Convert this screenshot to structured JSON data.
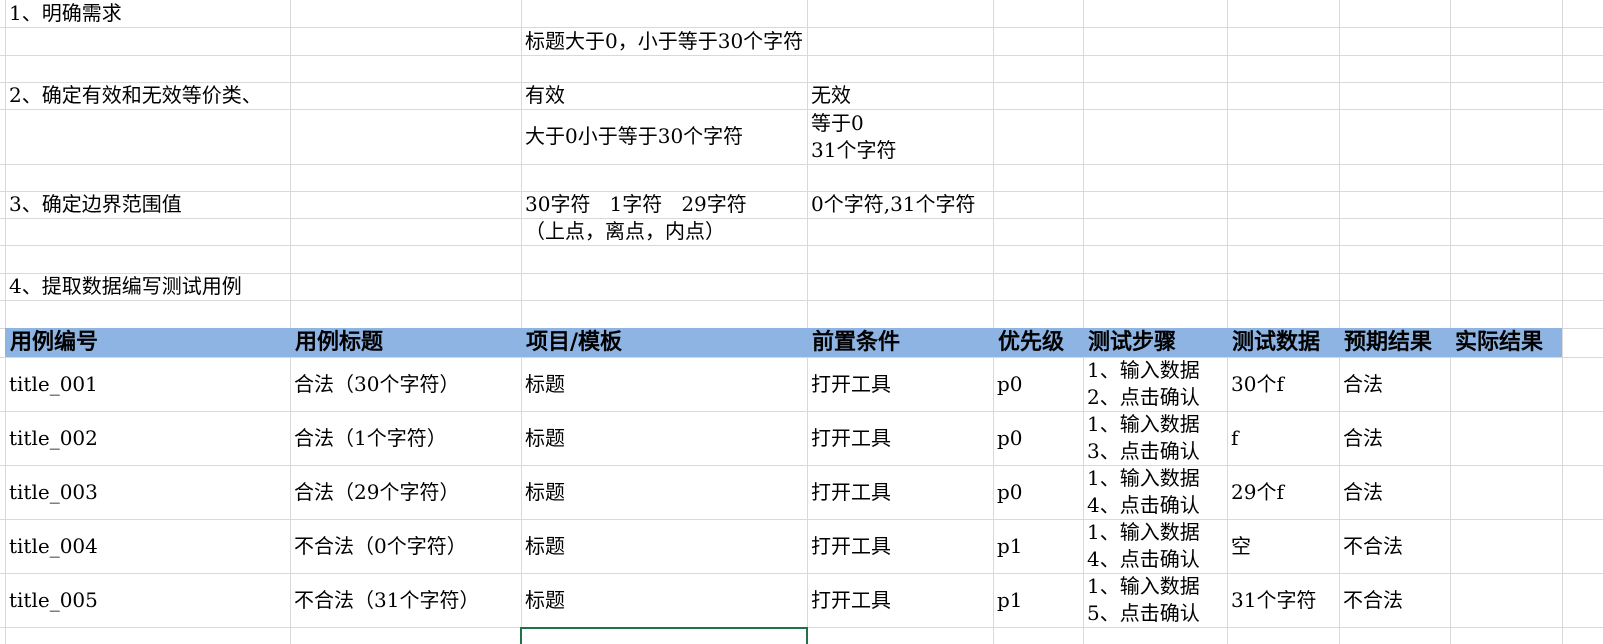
{
  "colors": {
    "header_fill": "#8DB4E2",
    "gridline": "#D9D9D9",
    "selection_border": "#217346"
  },
  "analysis": {
    "step1_label": "1、明确需求",
    "requirement": "标题大于0，小于等于30个字符",
    "step2_label": "2、确定有效和无效等价类、",
    "valid_label": "有效",
    "invalid_label": "无效",
    "valid_class": "大于0小于等于30个字符",
    "invalid_classes": [
      "等于0",
      "31个字符"
    ],
    "step3_label": "3、确定边界范围值",
    "boundary_valid": "30字符   1字符   29字符",
    "boundary_note": "（上点，离点，内点）",
    "boundary_invalid": "0个字符,31个字符",
    "step4_label": "4、提取数据编写测试用例"
  },
  "test_cases": {
    "headers": [
      "用例编号",
      "用例标题",
      "项目/模板",
      "前置条件",
      "优先级",
      "测试步骤",
      "测试数据",
      "预期结果",
      "实际结果"
    ],
    "rows": [
      {
        "id": "title_001",
        "title": "合法（30个字符）",
        "module": "标题",
        "precondition": "打开工具",
        "priority": "p0",
        "steps": [
          "1、输入数据",
          "2、点击确认"
        ],
        "data": "30个f",
        "expected": "合法"
      },
      {
        "id": "title_002",
        "title": "合法（1个字符）",
        "module": "标题",
        "precondition": "打开工具",
        "priority": "p0",
        "steps": [
          "1、输入数据",
          "3、点击确认"
        ],
        "data": "f",
        "expected": "合法"
      },
      {
        "id": "title_003",
        "title": "合法（29个字符）",
        "module": "标题",
        "precondition": "打开工具",
        "priority": "p0",
        "steps": [
          "1、输入数据",
          "4、点击确认"
        ],
        "data": "29个f",
        "expected": "合法"
      },
      {
        "id": "title_004",
        "title": "不合法（0个字符）",
        "module": "标题",
        "precondition": "打开工具",
        "priority": "p1",
        "steps": [
          "1、输入数据",
          "4、点击确认"
        ],
        "data": "空",
        "expected": "不合法"
      },
      {
        "id": "title_005",
        "title": "不合法（31个字符）",
        "module": "标题",
        "precondition": "打开工具",
        "priority": "p1",
        "steps": [
          "1、输入数据",
          "5、点击确认"
        ],
        "data": "31个字符",
        "expected": "不合法"
      }
    ]
  }
}
